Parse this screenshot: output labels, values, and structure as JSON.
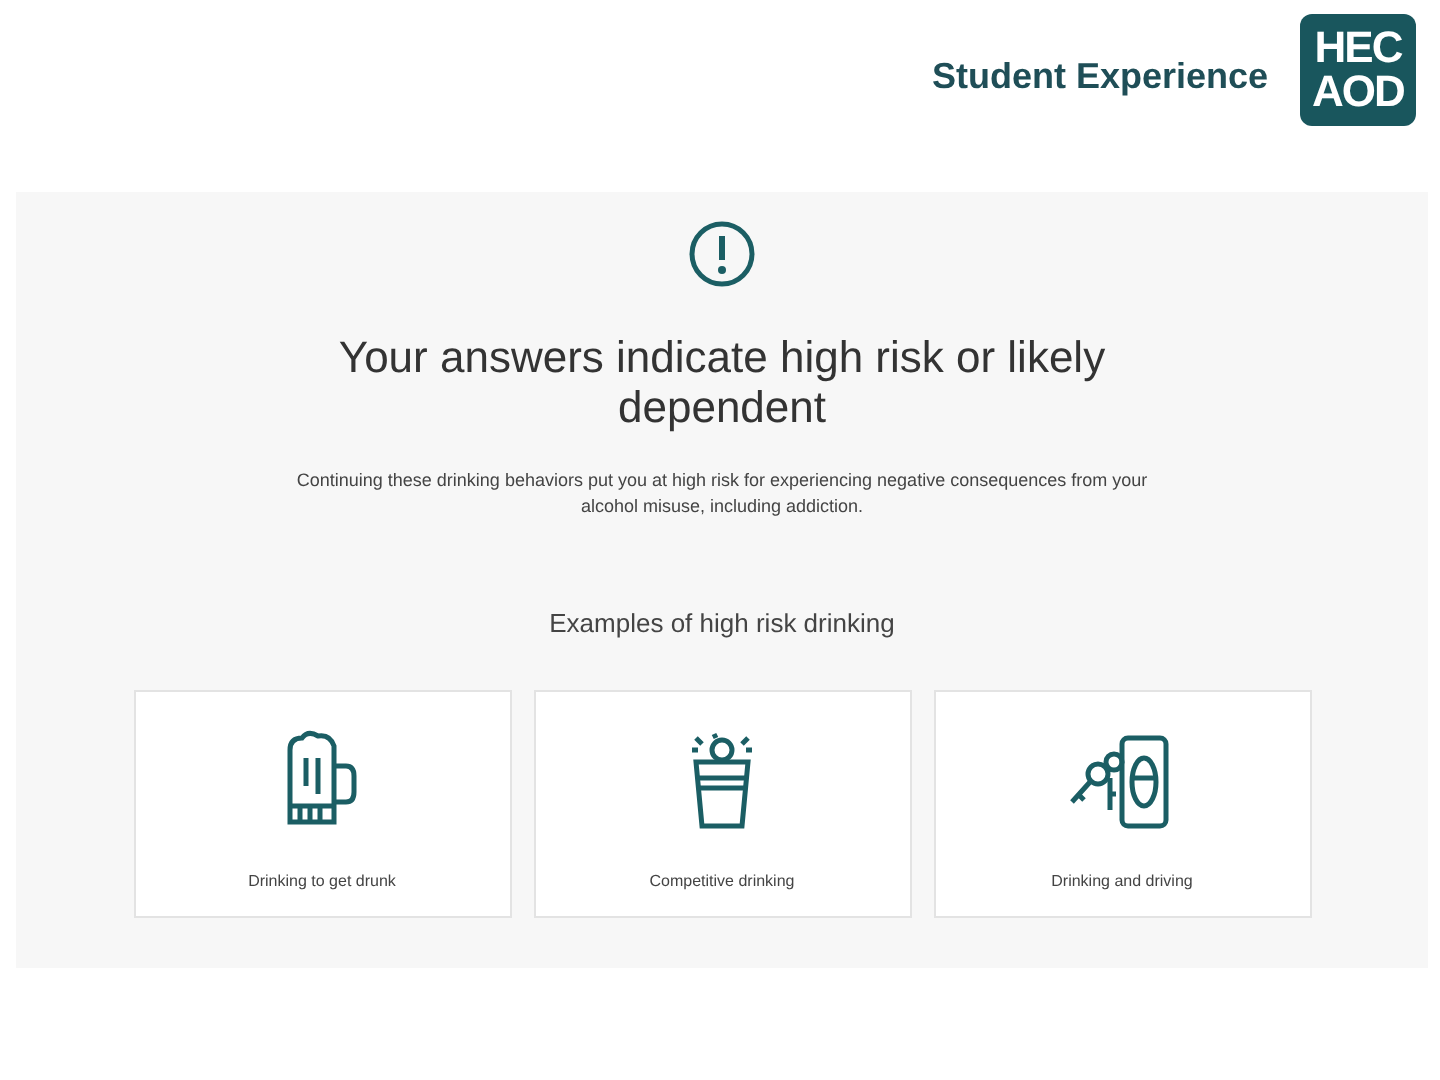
{
  "header": {
    "title": "Student Experience",
    "logo_lines": [
      "HEC",
      "AOD"
    ]
  },
  "result": {
    "heading": "Your answers indicate high risk or likely dependent",
    "message": "Continuing these drinking behaviors put you at high risk for experiencing negative consequences from your alcohol misuse, including addiction.",
    "examples_heading": "Examples of high risk drinking",
    "examples": [
      {
        "kind": "mug",
        "label": "Drinking to get drunk"
      },
      {
        "kind": "cup",
        "label": "Competitive drinking"
      },
      {
        "kind": "keys-can",
        "label": "Drinking and driving"
      }
    ]
  }
}
